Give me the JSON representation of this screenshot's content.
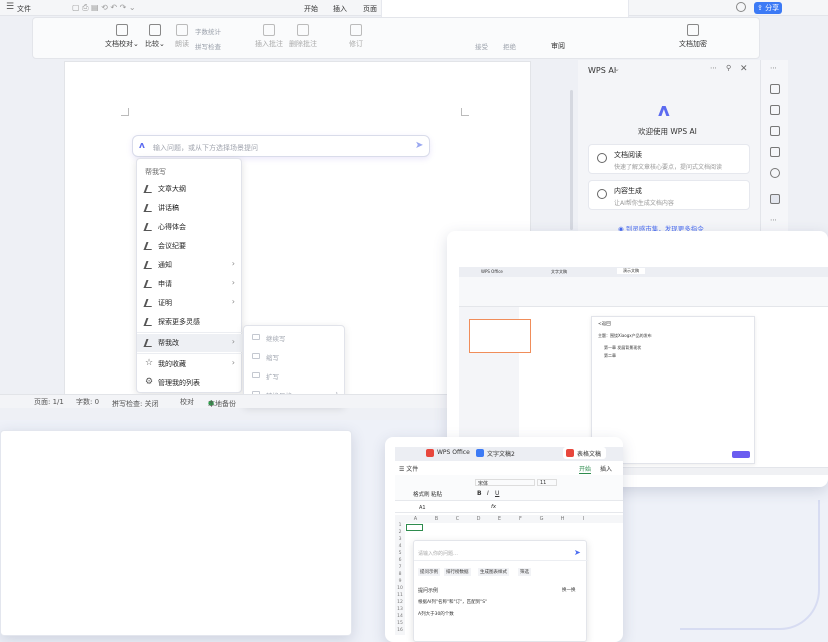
{
  "writer": {
    "menubar": {
      "file": "文件",
      "tabs": [
        "开始",
        "插入",
        "页面"
      ],
      "share": "分享"
    },
    "ribbon": {
      "buttons": [
        "文档校对",
        "比较",
        "朗读",
        "字数统计",
        "拼写检查",
        "插入批注",
        "删除批注",
        "修订",
        "审阅",
        "文档加密"
      ],
      "small_labels": [
        "字数统计",
        "拼写检查",
        "插入批注",
        "删除批注",
        "修订",
        "接受",
        "拒绝"
      ]
    },
    "ai_input": {
      "placeholder": "输入问题，或从下方选择场景提问"
    },
    "ai_menu": {
      "header": "帮我写",
      "items": [
        "文章大纲",
        "讲话稿",
        "心得体会",
        "会议纪要",
        "通知",
        "申请",
        "证明",
        "探索更多灵感",
        "帮我改",
        "我的收藏",
        "管理我的列表"
      ]
    },
    "ai_submenu": {
      "items": [
        "继续写",
        "缩写",
        "扩写",
        "转换风格"
      ]
    },
    "ai_panel": {
      "title": "WPS AI",
      "welcome": "欢迎使用 WPS AI",
      "cards": [
        {
          "title": "文档阅读",
          "desc": "快速了解文章核心要点，提问式文档阅读"
        },
        {
          "title": "内容生成",
          "desc": "让AI帮你生成文档内容"
        }
      ],
      "link": "到灵感市集，发现更多指令"
    },
    "statusbar": {
      "page": "页面: 1/1",
      "words": "字数: 0",
      "spell": "拼写检查: 关闭",
      "proof": "校对",
      "backup": "本地备份"
    }
  },
  "ppt_window": {
    "tabs": [
      "WPS Office",
      "文字文稿",
      "演示文稿"
    ],
    "panel_title": "<返回",
    "panel_lines": [
      "主题：围绕Xiaogx产品的发布",
      "第一章  发展背景现状",
      "第二章"
    ]
  },
  "et_window": {
    "tabs": [
      "WPS Office",
      "文字文稿2",
      "表格文稿"
    ],
    "file": "文件",
    "start": "开始",
    "insert": "插入",
    "font": "宋体",
    "font_size": "11",
    "cell_ref": "A1",
    "fx": "fx",
    "format_painter": "格式刷",
    "paste": "粘贴",
    "columns": [
      "A",
      "B",
      "C",
      "D",
      "E",
      "F",
      "G",
      "H",
      "I"
    ],
    "rows": [
      "1",
      "2",
      "3",
      "4",
      "5",
      "6",
      "7",
      "8",
      "9",
      "10",
      "11",
      "12",
      "13",
      "14",
      "15",
      "16"
    ],
    "ai_input_placeholder": "请输入你的问题…",
    "chips": [
      "提问示例",
      "排行榜数据",
      "生成图表样式",
      "筛选"
    ],
    "section_title": "提问示例",
    "page_indicator": "换一换",
    "examples": [
      "根据AI列\"名称\"和\"订\"，匹配到\"S\"",
      "A列大于30的个数"
    ]
  }
}
